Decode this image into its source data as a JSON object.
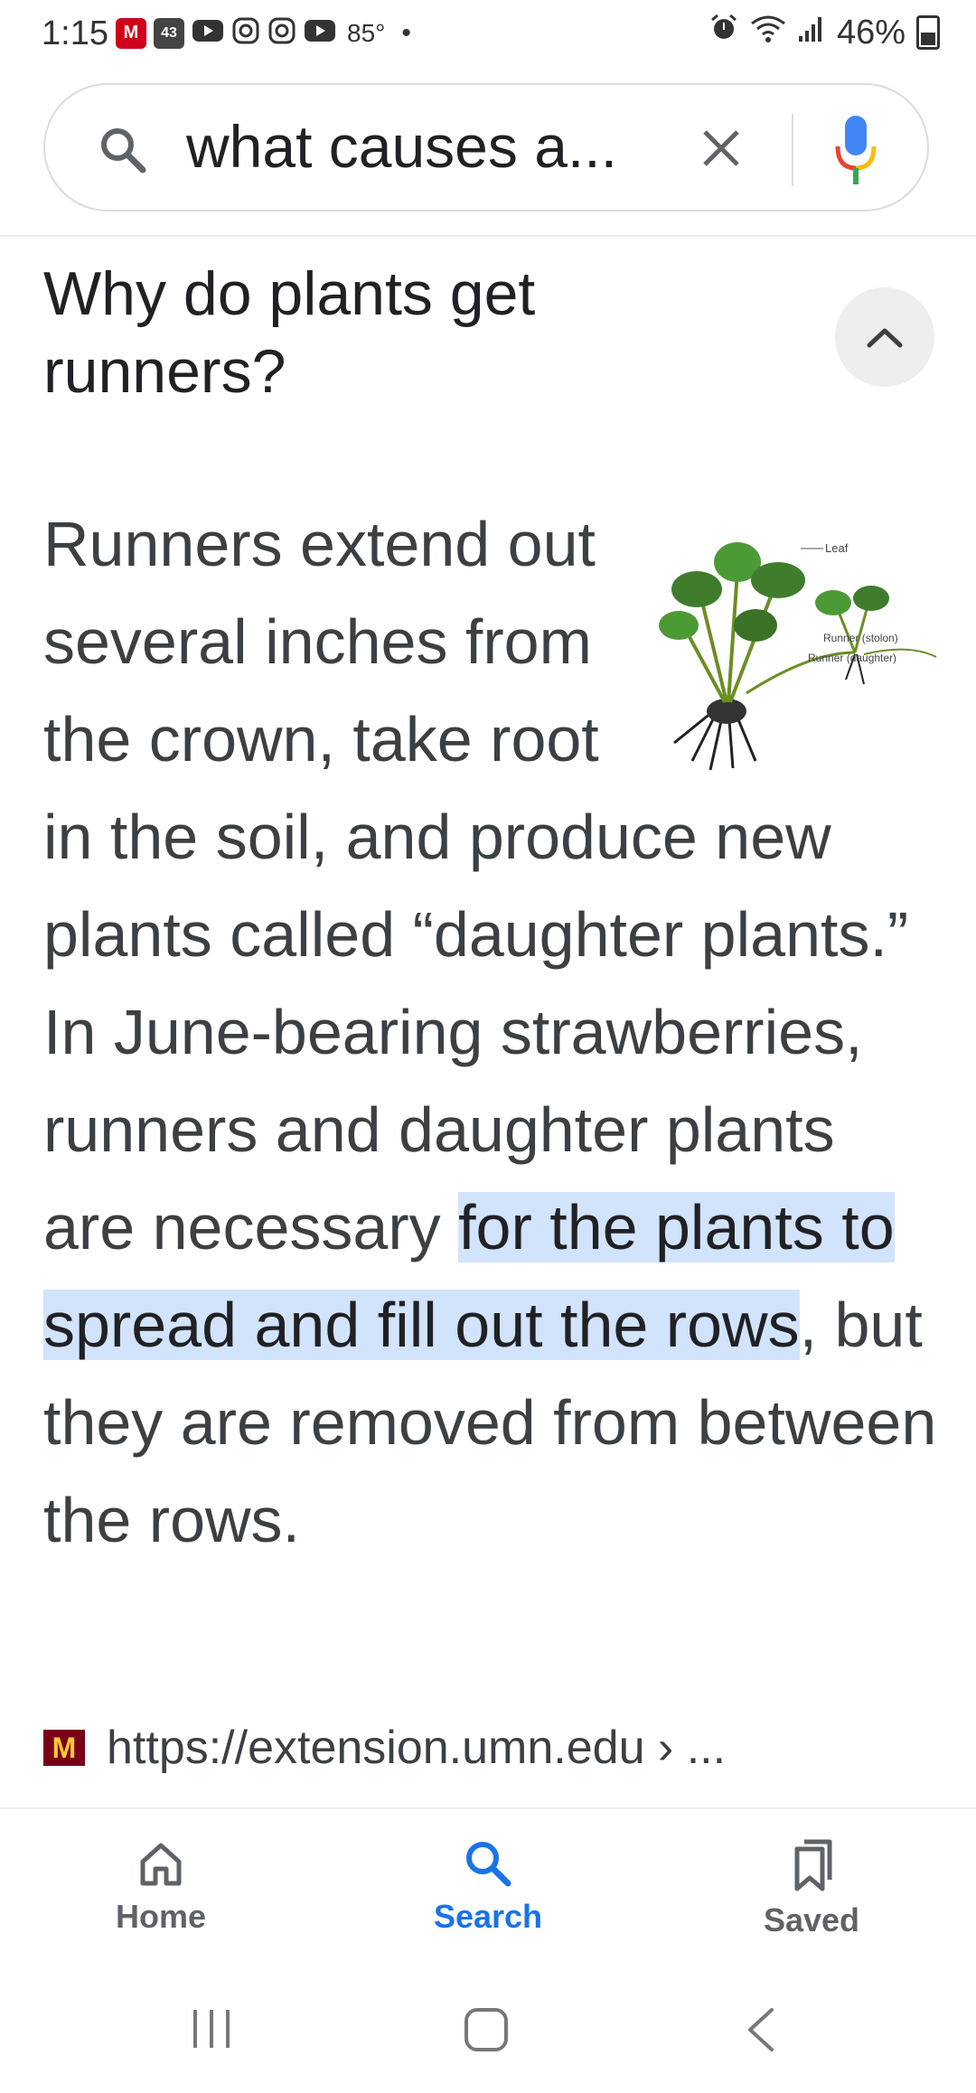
{
  "status_bar": {
    "time": "1:15",
    "app_icons": [
      "M",
      "43",
      "YT",
      "IG",
      "IG",
      "YT"
    ],
    "temperature": "85°",
    "dot": "•",
    "battery": "46%"
  },
  "search": {
    "query": "what causes a..."
  },
  "question": {
    "title": "Why do plants get runners?"
  },
  "answer": {
    "text_before": "Runners extend out several inches from the crown, take root in the soil, and produce new plants called “daughter plants.” In June-bearing strawberries, runners and daughter plants are necessary ",
    "highlight": "for the plants to spread and fill out the rows",
    "text_after": ", but they are removed from between the rows.",
    "image": {
      "leaf_label": "Leaf",
      "runner_label": "Runner (stolon)",
      "daughter_label": "Runner (daughter)"
    }
  },
  "source": {
    "favicon_letter": "M",
    "url": "https://extension.umn.edu › ..."
  },
  "bottom_nav": {
    "home": "Home",
    "search": "Search",
    "saved": "Saved"
  },
  "colors": {
    "accent": "#1a73e8",
    "highlight_bg": "#d2e3fc",
    "umn_maroon": "#7a0019"
  }
}
